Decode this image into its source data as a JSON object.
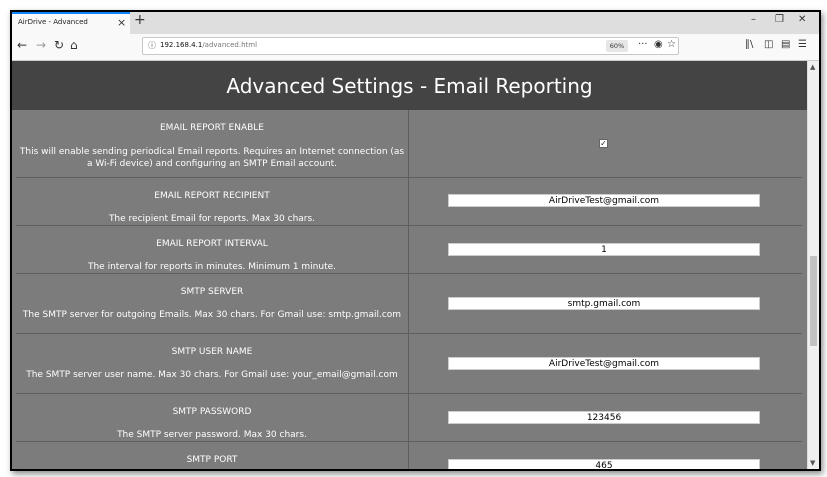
{
  "browser": {
    "tab_title": "AirDrive - Advanced",
    "tab_close": "×",
    "new_tab": "+",
    "url_host": "192.168.4.1",
    "url_path": "/advanced.html",
    "zoom": "60%"
  },
  "page": {
    "title": "Advanced Settings - Email Reporting"
  },
  "settings": [
    {
      "label": "EMAIL REPORT ENABLE",
      "description": "This will enable sending periodical Email reports. Requires an Internet connection (as a Wi-Fi device) and configuring an SMTP Email account.",
      "type": "checkbox",
      "checked": true
    },
    {
      "label": "EMAIL REPORT RECIPIENT",
      "description": "The recipient Email for reports. Max 30 chars.",
      "type": "text",
      "value": "AirDriveTest@gmail.com"
    },
    {
      "label": "EMAIL REPORT INTERVAL",
      "description": "The interval for reports in minutes. Minimum 1 minute.",
      "type": "text",
      "value": "1"
    },
    {
      "label": "SMTP SERVER",
      "description": "The SMTP server for outgoing Emails. Max 30 chars. For Gmail use: smtp.gmail.com",
      "type": "text",
      "value": "smtp.gmail.com"
    },
    {
      "label": "SMTP USER NAME",
      "description": "The SMTP server user name. Max 30 chars. For Gmail use: your_email@gmail.com",
      "type": "text",
      "value": "AirDriveTest@gmail.com"
    },
    {
      "label": "SMTP PASSWORD",
      "description": "The SMTP server password. Max 30 chars.",
      "type": "text",
      "value": "123456"
    },
    {
      "label": "SMTP PORT",
      "description": "",
      "type": "text",
      "value": "465"
    }
  ]
}
